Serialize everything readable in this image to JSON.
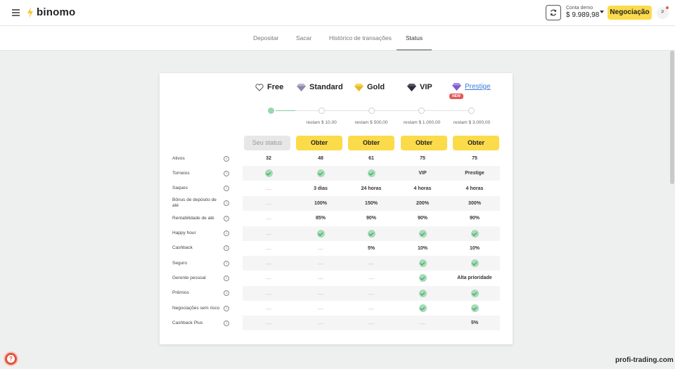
{
  "header": {
    "brand": "binomo",
    "account_label": "Conta demo",
    "balance": "$ 9.989,98",
    "trade_button": "Negociação",
    "avatar_initial": "P",
    "accent_color": "#fbdb4a"
  },
  "tabs": [
    {
      "label": "Depositar"
    },
    {
      "label": "Sacar"
    },
    {
      "label": "Histórico de transações"
    },
    {
      "label": "Status",
      "active": true
    }
  ],
  "tiers": [
    {
      "name": "Free",
      "icon": "heart-outline-icon",
      "button": "Seu status",
      "remaining": "",
      "current": true
    },
    {
      "name": "Standard",
      "icon": "diamond-silver-icon",
      "button": "Obter",
      "remaining": "restam $ 10,00"
    },
    {
      "name": "Gold",
      "icon": "diamond-gold-icon",
      "button": "Obter",
      "remaining": "restam $ 500,00"
    },
    {
      "name": "VIP",
      "icon": "diamond-dark-icon",
      "button": "Obter",
      "remaining": "restam $ 1.000,00"
    },
    {
      "name": "Prestige",
      "icon": "diamond-purple-icon",
      "button": "Obter",
      "remaining": "restam $ 3.000,00",
      "badge": "NEW"
    }
  ],
  "rows": [
    {
      "label": "Ativos",
      "values": [
        "32",
        "48",
        "61",
        "75",
        "75"
      ]
    },
    {
      "label": "Torneios",
      "values": [
        "check",
        "check",
        "check",
        "VIP",
        "Prestige"
      ]
    },
    {
      "label": "Saques",
      "values": [
        "—",
        "3 dias",
        "24 horas",
        "4 horas",
        "4 horas"
      ]
    },
    {
      "label": "Bônus de depósito de até",
      "values": [
        "—",
        "100%",
        "150%",
        "200%",
        "300%"
      ]
    },
    {
      "label": "Rentabilidade de até",
      "values": [
        "—",
        "85%",
        "90%",
        "90%",
        "90%"
      ]
    },
    {
      "label": "Happy hour",
      "values": [
        "—",
        "check",
        "check",
        "check",
        "check"
      ]
    },
    {
      "label": "Cashback",
      "values": [
        "—",
        "—",
        "5%",
        "10%",
        "10%"
      ]
    },
    {
      "label": "Seguro",
      "values": [
        "—",
        "—",
        "—",
        "check",
        "check"
      ]
    },
    {
      "label": "Gerente pessoal",
      "values": [
        "—",
        "—",
        "—",
        "check",
        "Alta prioridade"
      ]
    },
    {
      "label": "Prêmios",
      "values": [
        "—",
        "—",
        "—",
        "check",
        "check"
      ]
    },
    {
      "label": "Negociações sem risco",
      "values": [
        "—",
        "—",
        "—",
        "check",
        "check"
      ]
    },
    {
      "label": "Cashback Plus",
      "values": [
        "—",
        "—",
        "—",
        "—",
        "5%"
      ]
    }
  ],
  "help_glyph": "?",
  "watermark": "profi-trading.com"
}
